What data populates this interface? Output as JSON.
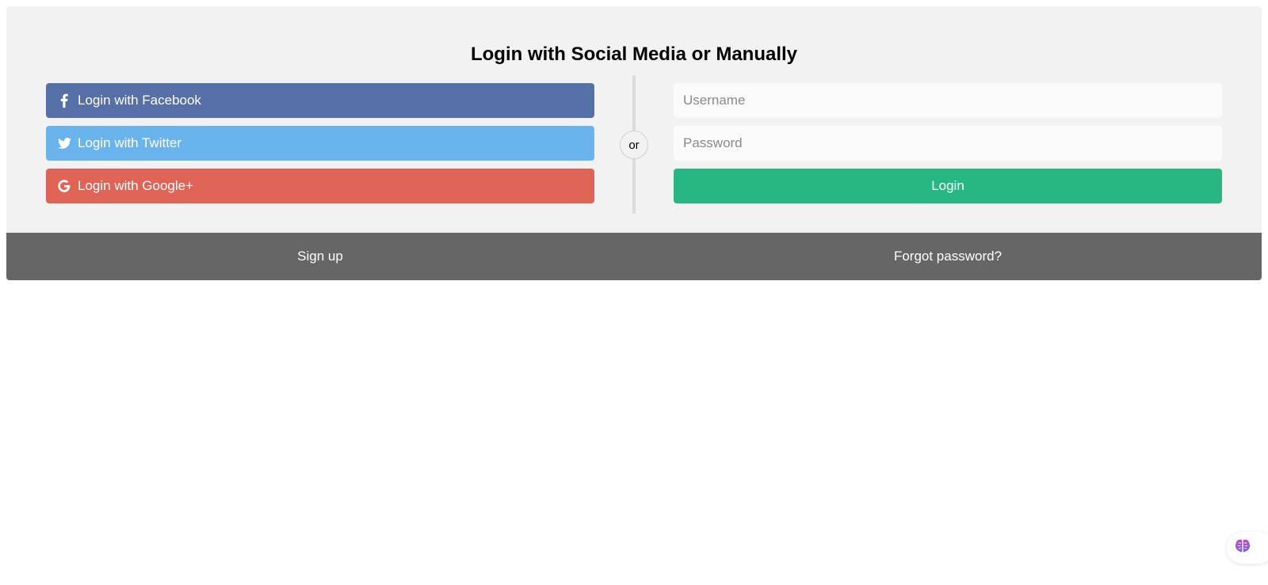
{
  "title": "Login with Social Media or Manually",
  "social": {
    "facebook_label": "Login with Facebook",
    "twitter_label": "Login with Twitter",
    "google_label": "Login with Google+"
  },
  "divider_label": "or",
  "form": {
    "username_placeholder": "Username",
    "password_placeholder": "Password",
    "login_label": "Login"
  },
  "footer": {
    "signup_label": "Sign up",
    "forgot_label": "Forgot password?"
  },
  "icons": {
    "facebook": "facebook-icon",
    "twitter": "twitter-icon",
    "google": "google-icon",
    "widget": "brain-icon"
  },
  "colors": {
    "facebook": "#5470a6",
    "twitter": "#6ab4ed",
    "google": "#e06455",
    "login": "#27b783",
    "footer": "#666666",
    "card": "#f2f2f2"
  }
}
